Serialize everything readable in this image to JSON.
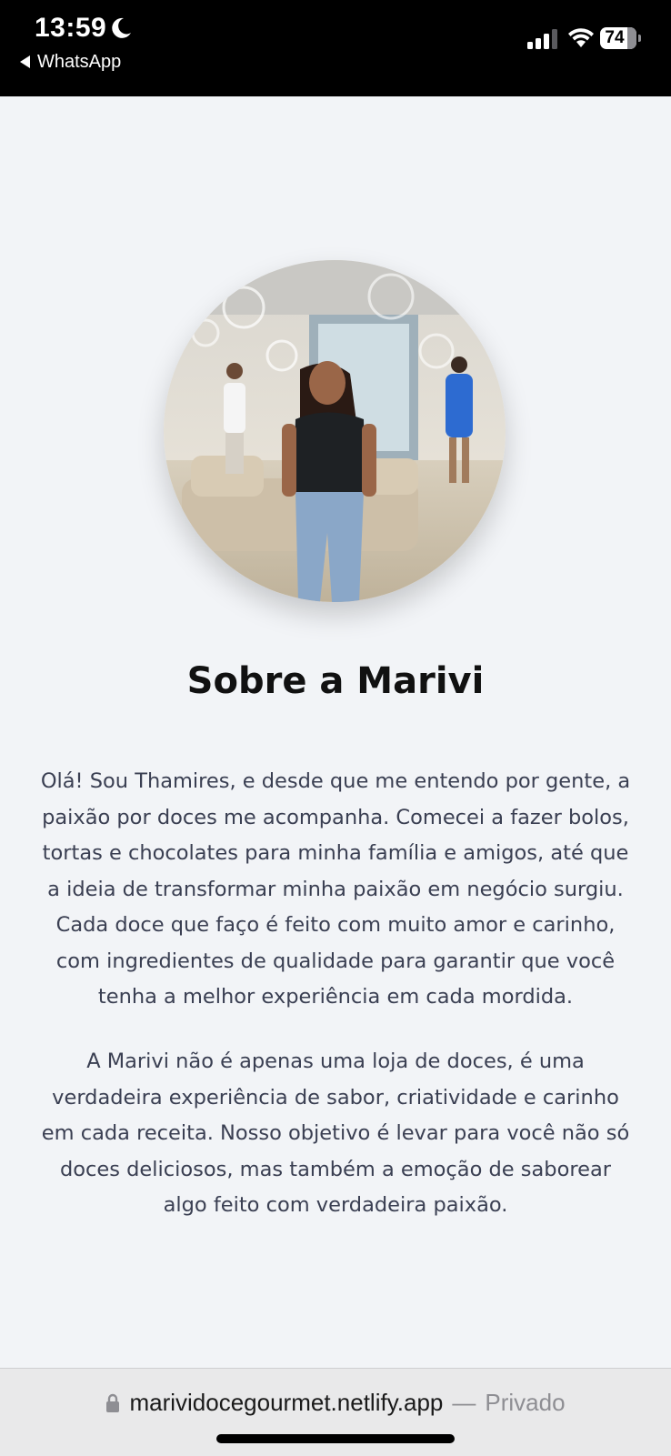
{
  "status_bar": {
    "time": "13:59",
    "back_app": "WhatsApp",
    "battery": "74",
    "icons": [
      "moon-icon",
      "back-arrow-icon",
      "signal-icon",
      "wifi-icon",
      "battery-icon"
    ]
  },
  "about": {
    "photo_alt": "Foto da Thamires",
    "title": "Sobre a Marivi",
    "paragraphs": [
      "Olá! Sou Thamires, e desde que me entendo por gente, a paixão por doces me acompanha. Comecei a fazer bolos, tortas e chocolates para minha família e amigos, até que a ideia de transformar minha paixão em negócio surgiu. Cada doce que faço é feito com muito amor e carinho, com ingredientes de qualidade para garantir que você tenha a melhor experiência em cada mordida.",
      "A Marivi não é apenas uma loja de doces, é uma verdadeira experiência de sabor, criatividade e carinho em cada receita. Nosso objetivo é levar para você não só doces deliciosos, mas também a emoção de saborear algo feito com verdadeira paixão."
    ]
  },
  "browser": {
    "url": "marividocegourmet.netlify.app",
    "separator": "—",
    "mode": "Privado"
  },
  "colors": {
    "background": "#f2f4f7",
    "title": "#111111",
    "text": "#3a3f52",
    "status_bar": "#000000"
  }
}
